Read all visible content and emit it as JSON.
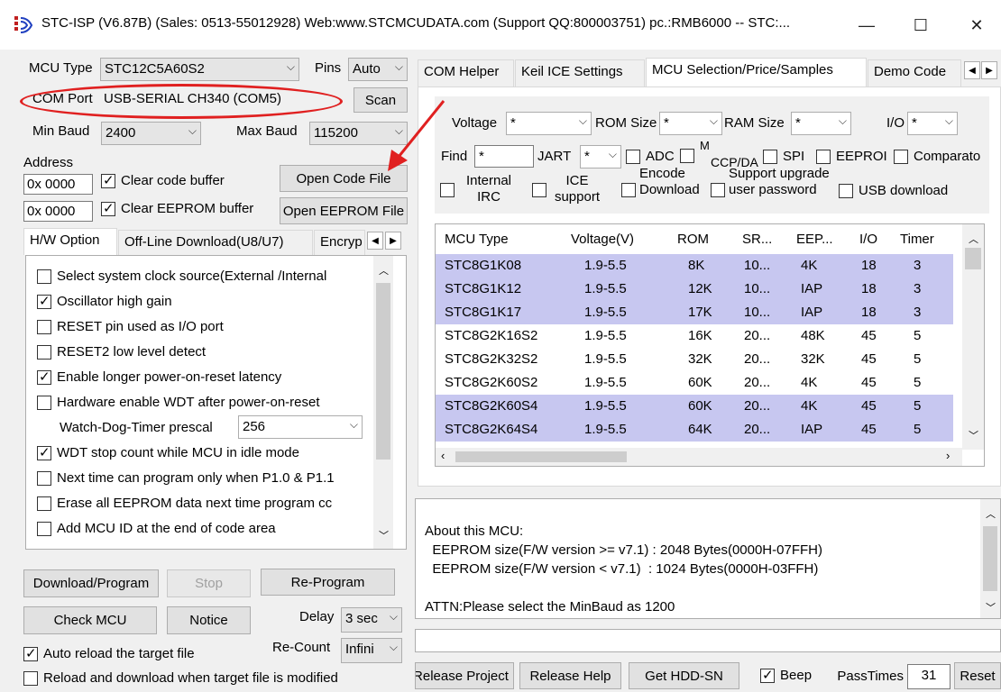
{
  "window": {
    "title": "STC-ISP (V6.87B) (Sales: 0513-55012928) Web:www.STCMCUDATA.com  (Support QQ:800003751)  pc.:RMB6000 -- STC:...",
    "minimize": "—",
    "maximize": "☐",
    "close": "✕"
  },
  "left": {
    "mcu_type_label": "MCU Type",
    "mcu_type_value": "STC12C5A60S2",
    "pins_label": "Pins",
    "pins_value": "Auto",
    "com_port_label": "COM Port",
    "com_port_value": "USB-SERIAL CH340 (COM5)",
    "scan": "Scan",
    "min_baud_label": "Min Baud",
    "min_baud_value": "2400",
    "max_baud_label": "Max Baud",
    "max_baud_value": "115200",
    "address_label": "Address",
    "addr1": "0x 0000",
    "addr2": "0x 0000",
    "clear_code": "Clear code buffer",
    "clear_eeprom": "Clear EEPROM buffer",
    "open_code": "Open Code File",
    "open_eeprom": "Open EEPROM File",
    "tabs": [
      "H/W Option",
      "Off-Line Download(U8/U7)",
      "Encryp"
    ],
    "options": [
      {
        "label": "Select system clock source(External /Internal",
        "checked": false
      },
      {
        "label": "Oscillator high gain",
        "checked": true
      },
      {
        "label": "RESET pin used as I/O port",
        "checked": false
      },
      {
        "label": "RESET2 low level detect",
        "checked": false
      },
      {
        "label": "Enable longer power-on-reset latency",
        "checked": true
      },
      {
        "label": "Hardware enable WDT after power-on-reset",
        "checked": false
      },
      {
        "label": "WDT stop count while MCU in idle mode",
        "checked": true
      },
      {
        "label": "Next time can program only when P1.0 & P1.1",
        "checked": false
      },
      {
        "label": "Erase all EEPROM data next time program cc",
        "checked": false
      },
      {
        "label": "Add MCU ID at the end of code area",
        "checked": false
      }
    ],
    "wdt_prescal_label": "Watch-Dog-Timer prescal",
    "wdt_prescal_value": "256",
    "download": "Download/Program",
    "stop": "Stop",
    "reprogram": "Re-Program",
    "check_mcu": "Check MCU",
    "notice": "Notice",
    "delay_label": "Delay",
    "delay_value": "3 sec",
    "recount_label": "Re-Count",
    "recount_value": "Infini",
    "auto_reload": "Auto reload the target file",
    "reload_download": "Reload and download when target file is modified"
  },
  "right": {
    "tabs": [
      "COM Helper",
      "Keil ICE Settings",
      "MCU Selection/Price/Samples",
      "Demo Code"
    ],
    "voltage_label": "Voltage",
    "voltage_value": "*",
    "rom_label": "ROM Size",
    "rom_value": "*",
    "ram_label": "RAM Size",
    "ram_value": "*",
    "io_label": "I/O",
    "io_value": "*",
    "find_label": "Find",
    "find_value": "*",
    "uart_label": "JART",
    "uart_value": "*",
    "adc": "ADC",
    "ccp_top": "M",
    "ccp": "CCP/DA",
    "spi": "SPI",
    "eeprom": "EEPROI",
    "comparator": "Comparato",
    "internal_irc": "Internal IRC",
    "ice_support": "ICE support",
    "encode_download": "Encode Download",
    "support_upgrade": "Support upgrade user password",
    "usb_download": "USB download",
    "columns": [
      "MCU Type",
      "Voltage(V)",
      "ROM",
      "SR...",
      "EEP...",
      "I/O",
      "Timer"
    ],
    "rows": [
      {
        "mcu": "STC8G1K08",
        "voltage": "1.9-5.5",
        "rom": "8K",
        "sram": "10...",
        "eep": "4K",
        "io": "18",
        "timer": "3",
        "selected": true
      },
      {
        "mcu": "STC8G1K12",
        "voltage": "1.9-5.5",
        "rom": "12K",
        "sram": "10...",
        "eep": "IAP",
        "io": "18",
        "timer": "3",
        "selected": true
      },
      {
        "mcu": "STC8G1K17",
        "voltage": "1.9-5.5",
        "rom": "17K",
        "sram": "10...",
        "eep": "IAP",
        "io": "18",
        "timer": "3",
        "selected": true
      },
      {
        "mcu": "STC8G2K16S2",
        "voltage": "1.9-5.5",
        "rom": "16K",
        "sram": "20...",
        "eep": "48K",
        "io": "45",
        "timer": "5",
        "selected": false
      },
      {
        "mcu": "STC8G2K32S2",
        "voltage": "1.9-5.5",
        "rom": "32K",
        "sram": "20...",
        "eep": "32K",
        "io": "45",
        "timer": "5",
        "selected": false
      },
      {
        "mcu": "STC8G2K60S2",
        "voltage": "1.9-5.5",
        "rom": "60K",
        "sram": "20...",
        "eep": "4K",
        "io": "45",
        "timer": "5",
        "selected": false
      },
      {
        "mcu": "STC8G2K60S4",
        "voltage": "1.9-5.5",
        "rom": "60K",
        "sram": "20...",
        "eep": "4K",
        "io": "45",
        "timer": "5",
        "selected": true
      },
      {
        "mcu": "STC8G2K64S4",
        "voltage": "1.9-5.5",
        "rom": "64K",
        "sram": "20...",
        "eep": "IAP",
        "io": "45",
        "timer": "5",
        "selected": true
      }
    ],
    "info_lines": [
      "About this MCU:",
      "  EEPROM size(F/W version >= v7.1) : 2048 Bytes(0000H-07FFH)",
      "  EEPROM size(F/W version < v7.1)  : 1024 Bytes(0000H-03FFH)",
      "",
      "ATTN:Please select the MinBaud as 1200"
    ],
    "release_project": "Release Project",
    "release_help": "Release Help",
    "get_hdd": "Get HDD-SN",
    "beep": "Beep",
    "passtimes_label": "PassTimes",
    "passtimes_value": "31",
    "reset": "Reset"
  },
  "colors": {
    "selected_row": "#c7c7f0",
    "annotation": "#e02020"
  }
}
